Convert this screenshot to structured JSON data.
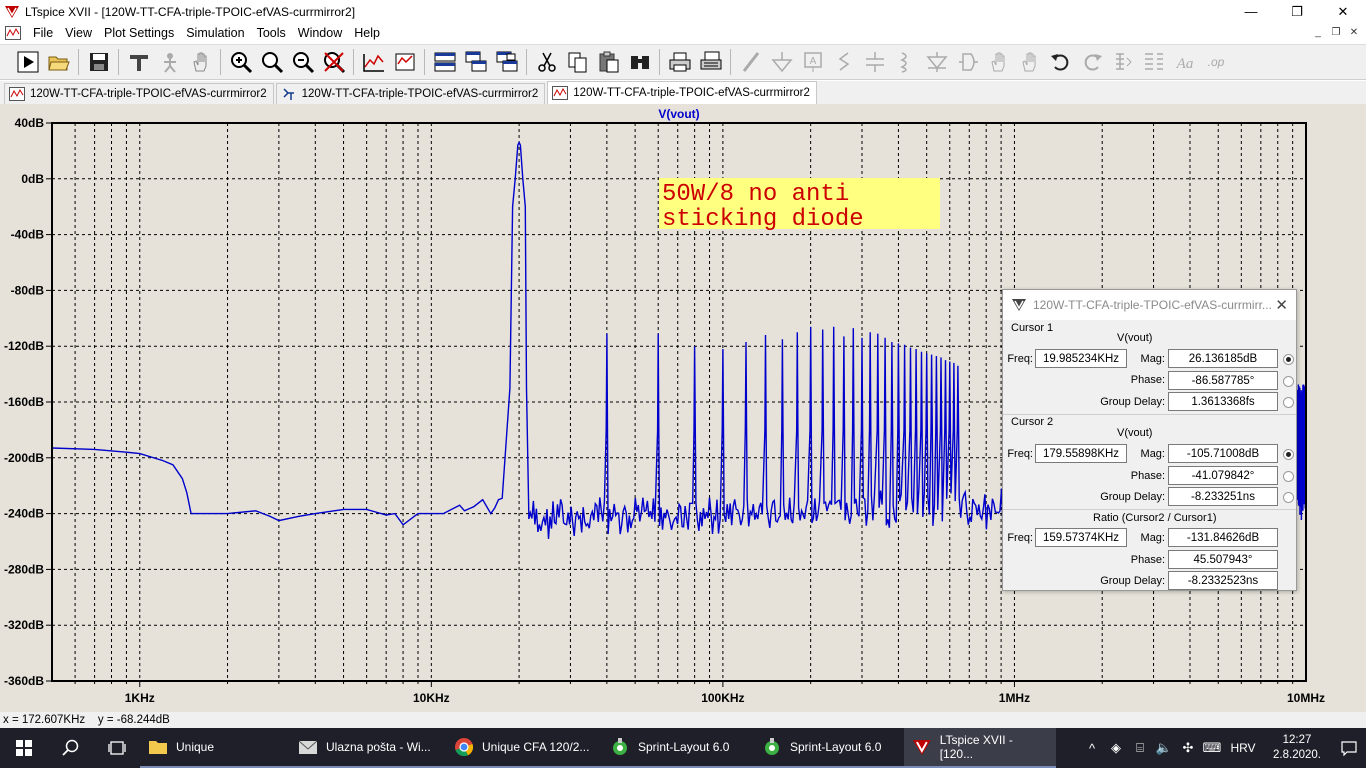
{
  "window": {
    "title": "LTspice XVII - [120W-TT-CFA-triple-TPOIC-efVAS-currmirror2]",
    "min": "—",
    "max": "❐",
    "close": "✕"
  },
  "menu": [
    "File",
    "View",
    "Plot Settings",
    "Simulation",
    "Tools",
    "Window",
    "Help"
  ],
  "mdi_buttons": [
    "_",
    "❐",
    "✕"
  ],
  "toolbar_icons": [
    "run-icon",
    "open-icon",
    "save-icon",
    "control-panel-icon",
    "halt-icon",
    "pan-icon",
    "zoom-in-icon",
    "zoom-out-icon",
    "zoom-out-full-icon",
    "zoom-cancel-icon",
    "autorange-icon",
    "fit-icon",
    "tile-horizontal-icon",
    "cascade-icon",
    "tile-vertical-icon",
    "cut-icon",
    "copy-icon",
    "paste-icon",
    "find-icon",
    "print-icon",
    "print-setup-icon",
    "wire-icon",
    "ground-icon",
    "label-icon",
    "resistor-icon",
    "capacitor-icon",
    "inductor-icon",
    "diode-icon",
    "component-icon",
    "move-icon",
    "drag-icon",
    "undo-icon",
    "redo-icon",
    "rotate-icon",
    "mirror-icon",
    "text-icon",
    "spice-directive-icon"
  ],
  "tabs": [
    {
      "label": "120W-TT-CFA-triple-TPOIC-efVAS-currmirror2",
      "icon": "waveform-icon",
      "active": false
    },
    {
      "label": "120W-TT-CFA-triple-TPOIC-efVAS-currmirror2",
      "icon": "schematic-icon",
      "active": false
    },
    {
      "label": "120W-TT-CFA-triple-TPOIC-efVAS-currmirror2",
      "icon": "waveform-icon",
      "active": true
    }
  ],
  "chart_data": {
    "type": "line",
    "trace_label": "V(vout)",
    "y_ticks": [
      "40dB",
      "0dB",
      "-40dB",
      "-80dB",
      "-120dB",
      "-160dB",
      "-200dB",
      "-240dB",
      "-280dB",
      "-320dB",
      "-360dB"
    ],
    "x_ticks": [
      "1KHz",
      "10KHz",
      "100KHz",
      "1MHz",
      "10MHz"
    ],
    "ylim": [
      -360,
      40
    ],
    "xlim_hz": [
      500,
      10000000
    ],
    "x_scale": "log",
    "grid": true,
    "trace_color": "#0000cc",
    "annotation": {
      "lines": [
        "50W/8 no anti",
        "sticking diode"
      ],
      "color": "#cc0000",
      "background": "#ffff80"
    },
    "fundamental_hz": 20000,
    "fundamental_db": 26.1,
    "harmonics_db": [
      -111,
      -111,
      -120,
      -122,
      -117,
      -112,
      -115,
      -110,
      -106,
      -108,
      -106,
      -113,
      -107,
      -114,
      -110,
      -111,
      -114,
      -117,
      -118,
      -119,
      -121,
      -122,
      -124,
      -125,
      -126,
      -127,
      -128,
      -130,
      -131,
      -132,
      -134
    ],
    "noise_floor_db": -240
  },
  "cursor_dialog": {
    "title": "120W-TT-CFA-triple-TPOIC-efVAS-currmirr...",
    "close": "✕",
    "cursor1": {
      "group": "Cursor 1",
      "trace": "V(vout)",
      "freq_label": "Freq:",
      "freq": "19.985234KHz",
      "mag_label": "Mag:",
      "mag": "26.136185dB",
      "phase_label": "Phase:",
      "phase": "-86.587785°",
      "gd_label": "Group Delay:",
      "gd": "1.3613368fs"
    },
    "cursor2": {
      "group": "Cursor 2",
      "trace": "V(vout)",
      "freq_label": "Freq:",
      "freq": "179.55898KHz",
      "mag_label": "Mag:",
      "mag": "-105.71008dB",
      "phase_label": "Phase:",
      "phase": "-41.079842°",
      "gd_label": "Group Delay:",
      "gd": "-8.233251ns"
    },
    "ratio": {
      "group": "Ratio (Cursor2 / Cursor1)",
      "freq_label": "Freq:",
      "freq": "159.57374KHz",
      "mag_label": "Mag:",
      "mag": "-131.84626dB",
      "phase_label": "Phase:",
      "phase": "45.507943°",
      "gd_label": "Group Delay:",
      "gd": "-8.2332523ns"
    }
  },
  "statusbar": {
    "text": "x = 172.607KHz    y = -68.244dB"
  },
  "taskbar": {
    "apps": [
      {
        "label": "Unique",
        "icon": "folder-icon",
        "active": false
      },
      {
        "label": "Ulazna pošta - Wi...",
        "icon": "mail-icon",
        "active": false
      },
      {
        "label": "Unique CFA 120/2...",
        "icon": "chrome-icon",
        "active": false
      },
      {
        "label": "Sprint-Layout 6.0",
        "icon": "sprint-layout-icon",
        "active": false
      },
      {
        "label": "Sprint-Layout 6.0",
        "icon": "sprint-layout-icon",
        "active": false
      },
      {
        "label": "LTspice XVII - [120...",
        "icon": "ltspice-icon",
        "active": true
      }
    ],
    "tray_lang": "HRV",
    "time": "12:27",
    "date": "2.8.2020."
  }
}
